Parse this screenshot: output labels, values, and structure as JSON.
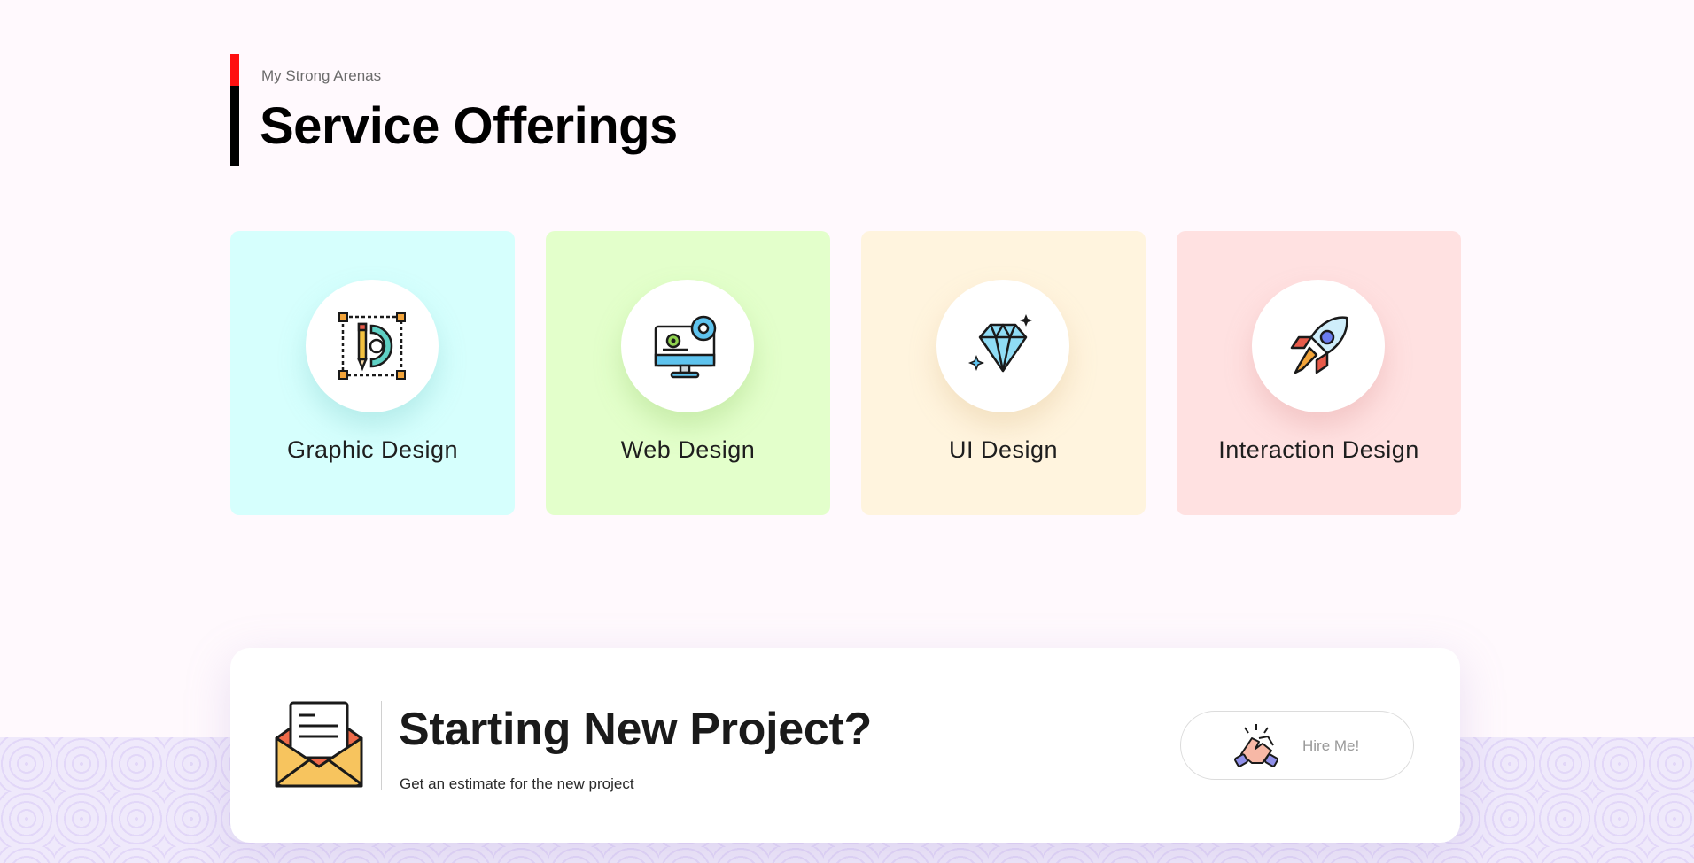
{
  "section": {
    "subtitle": "My Strong Arenas",
    "title": "Service Offerings"
  },
  "services": [
    {
      "label": "Graphic Design",
      "icon": "graphic-design-icon",
      "bg": "#d6fffd"
    },
    {
      "label": "Web Design",
      "icon": "web-design-icon",
      "bg": "#e3ffcb"
    },
    {
      "label": "UI Design",
      "icon": "ui-design-icon",
      "bg": "#fff4de"
    },
    {
      "label": "Interaction Design",
      "icon": "interaction-design-icon",
      "bg": "#ffe1e1"
    }
  ],
  "cta": {
    "title": "Starting New Project?",
    "subtitle": "Get an estimate for the new project",
    "button_label": "Hire Me!",
    "icon": "envelope-letter-icon",
    "button_icon": "handshake-icon"
  },
  "colors": {
    "accent_red": "#ff1010",
    "page_bg": "#fff9fd"
  }
}
